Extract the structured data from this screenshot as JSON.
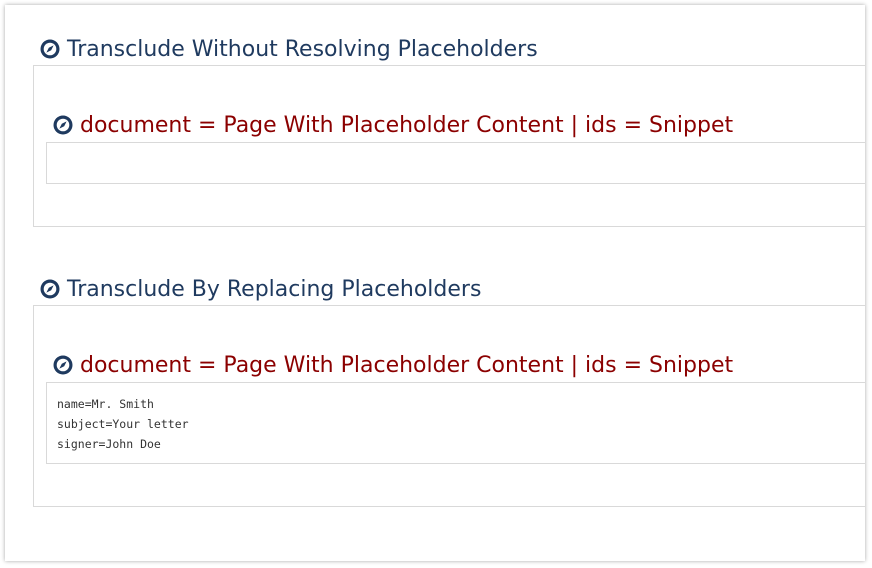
{
  "sections": [
    {
      "title": "Transclude Without Resolving Placeholders",
      "macro_title": "document = Page With Placeholder Content | ids = Snippet",
      "content_lines": []
    },
    {
      "title": "Transclude By Replacing Placeholders",
      "macro_title": "document = Page With Placeholder Content | ids = Snippet",
      "content_lines": [
        "name=Mr. Smith",
        "subject=Your letter",
        "signer=John Doe"
      ]
    }
  ],
  "colors": {
    "section_title": "#1f3a5f",
    "macro_title": "#8b0000",
    "icon": "#1f3a5f",
    "border": "#d9d9d9"
  },
  "icons": {
    "section": "compass-icon",
    "macro": "compass-icon"
  }
}
